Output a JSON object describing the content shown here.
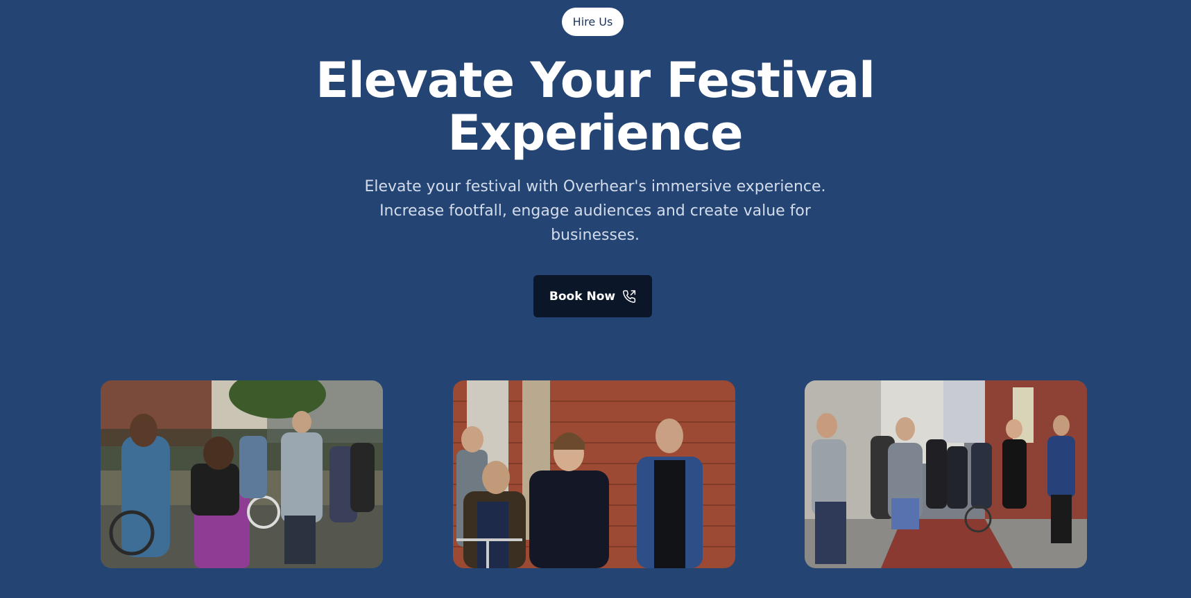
{
  "hero": {
    "badge": "Hire Us",
    "title_line1": "Elevate Your Festival",
    "title_line2": "Experience",
    "subtitle_line1": "Elevate your festival with Overhear's immersive experience.",
    "subtitle_line2": "Increase footfall, engage audiences and create value for",
    "subtitle_line3": "businesses.",
    "cta_label": "Book Now",
    "cta_icon": "phone-outgoing-icon"
  },
  "colors": {
    "background": "#244474",
    "badge_bg": "#ffffff",
    "cta_bg": "#0c1629",
    "title": "#ffffff",
    "subtitle": "#d3dcea"
  },
  "gallery": [
    {
      "name": "festival-crowd-headphones-photo"
    },
    {
      "name": "group-brick-wall-photo"
    },
    {
      "name": "street-audience-photo"
    }
  ]
}
